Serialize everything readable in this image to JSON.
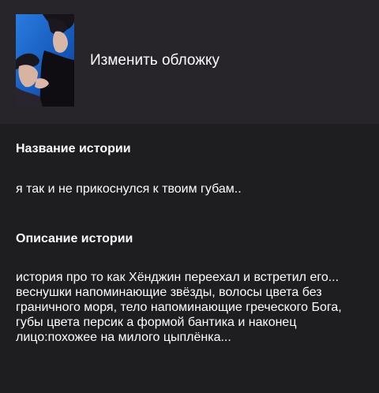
{
  "header": {
    "change_cover_label": "Изменить обложку",
    "cover_image": "cover-photo"
  },
  "story": {
    "title_label": "Название истории",
    "title_value": "я так и не прикоснулся к твоим губам..",
    "description_label": "Описание истории",
    "description_value": "история про то как Хёнджин переехал и встретил его...\nвеснушки напоминающие звёзды, волосы цвета без граничного моря, тело напоминающие греческого Бога, губы цвета персик а формой бантика и наконец лицо:похожее на милого цыплёнка..."
  },
  "colors": {
    "header_bg": "#272529",
    "content_bg": "#1e1d1f",
    "text": "#ffffff",
    "cover_accent": "#1a66c4"
  }
}
